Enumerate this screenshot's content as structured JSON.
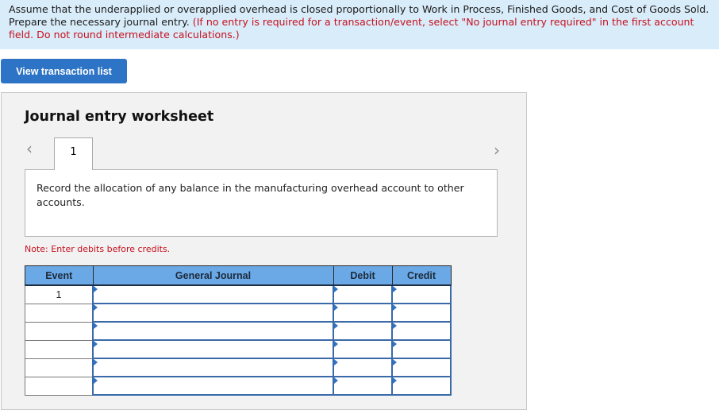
{
  "instructions": {
    "text": "Assume that the underapplied or overapplied overhead is closed proportionally to Work in Process, Finished Goods, and Cost of Goods Sold. Prepare the necessary journal entry.",
    "note": "(If no entry is required for a transaction/event, select \"No journal entry required\" in the first account field. Do not round intermediate calculations.)"
  },
  "view_transaction_button": "View transaction list",
  "worksheet": {
    "title": "Journal entry worksheet",
    "prev_icon": "chevron-left-icon",
    "next_icon": "chevron-right-icon",
    "active_tab": "1",
    "description": "Record the allocation of any balance in the manufacturing overhead account to other accounts.",
    "note": "Note: Enter debits before credits."
  },
  "table": {
    "headers": [
      "Event",
      "General Journal",
      "Debit",
      "Credit"
    ],
    "rows": [
      {
        "event": "1",
        "account": "",
        "debit": "",
        "credit": ""
      },
      {
        "event": "",
        "account": "",
        "debit": "",
        "credit": ""
      },
      {
        "event": "",
        "account": "",
        "debit": "",
        "credit": ""
      },
      {
        "event": "",
        "account": "",
        "debit": "",
        "credit": ""
      },
      {
        "event": "",
        "account": "",
        "debit": "",
        "credit": ""
      },
      {
        "event": "",
        "account": "",
        "debit": "",
        "credit": ""
      }
    ]
  },
  "colors": {
    "instruction_bg": "#d9ecf9",
    "accent": "#2e74c6",
    "header_bg": "#6aa8e6",
    "note_red": "#c8101e"
  }
}
